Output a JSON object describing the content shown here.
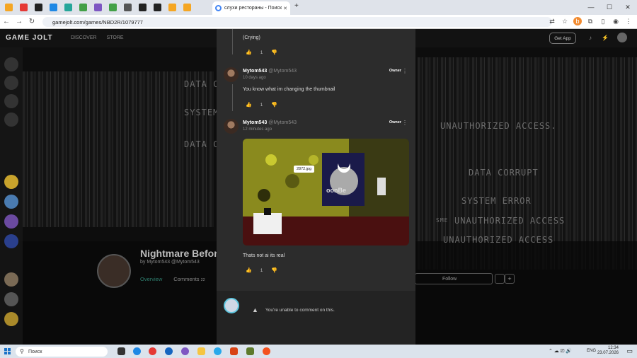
{
  "browser": {
    "active_tab_title": "слухи рестораны - Поиск в G",
    "new_tab": "+",
    "url": "gamejolt.com/games/NBD2R/1079777",
    "tab_favicons": [
      "#f5a623",
      "#e53935",
      "#222222",
      "#1e88e5",
      "#26a69a",
      "#43a047",
      "#7e57c2",
      "#43a047",
      "#555555",
      "#222222",
      "#222222",
      "#f5a623",
      "#f5a623"
    ]
  },
  "gamejolt": {
    "logo": "GAME JOLT",
    "nav": [
      "DISCOVER",
      "STORE"
    ],
    "get_app": "Get App",
    "game_title": "Nightmare Before",
    "byline": "by Mytom543 @Mytom543",
    "tabs": [
      "Overview",
      "Comments",
      "22",
      "Fo"
    ],
    "follow": "Follow",
    "glitch_lines_left": [
      "DATA COR",
      "SYSTEM ER",
      "DATA COR"
    ],
    "glitch_lines_right": [
      "UNAUTHORIZED ACCESS.",
      "DATA CORRUPT",
      "SYSTEM ERROR",
      "UNAUTHORIZED ACCESS",
      "UNAUTHORIZED ACCESS"
    ],
    "glitch_small": "SME"
  },
  "modal": {
    "c1": {
      "text": "(Crying)",
      "votes": "1"
    },
    "c2": {
      "author": "Mytom543",
      "handle": "@Mytom543",
      "date": "10 days ago",
      "badge": "Owner",
      "text": "You know what im changing the thumbnail",
      "votes": "1"
    },
    "c3": {
      "author": "Mytom543",
      "handle": "@Mytom543",
      "date": "12 minutes ago",
      "badge": "Owner",
      "attachment_label": "2872.jpg",
      "attachment_sign": "oonBe",
      "text": "Thats not ai its real",
      "votes": "1"
    },
    "cannot_comment": "You're unable to comment on this."
  },
  "taskbar": {
    "search_placeholder": "Поиск",
    "lang": "ENG",
    "time": "12:34",
    "date": "23.07.2026"
  }
}
